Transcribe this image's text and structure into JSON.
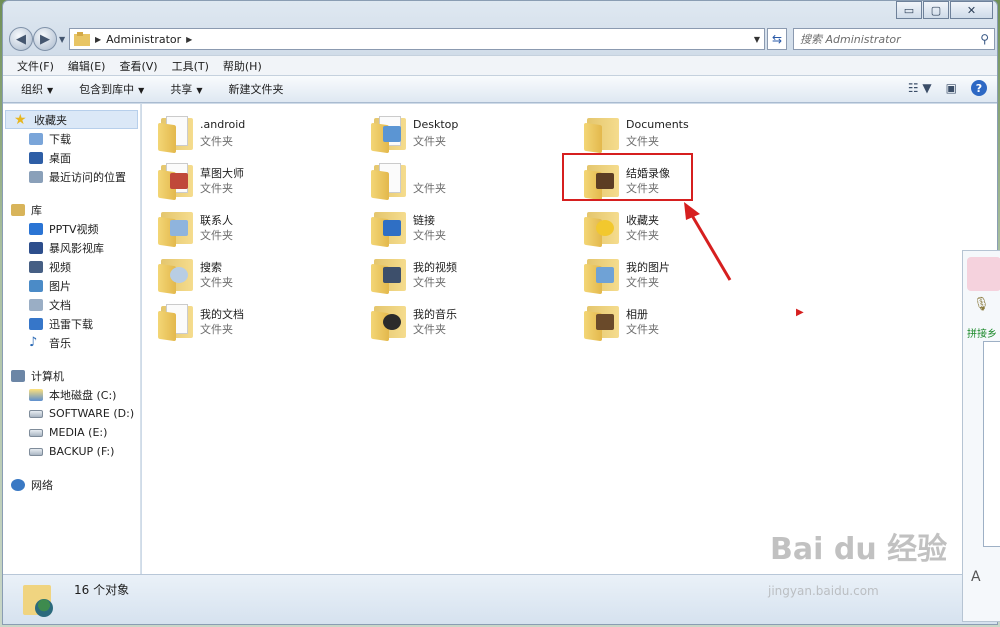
{
  "window": {
    "caption": {
      "min": "▭",
      "max": "▢",
      "close": "✕"
    },
    "address": {
      "path": "Administrator"
    },
    "search": {
      "placeholder": "搜索 Administrator"
    }
  },
  "menubar": [
    "文件(F)",
    "编辑(E)",
    "查看(V)",
    "工具(T)",
    "帮助(H)"
  ],
  "cmdbar": {
    "organize": "组织",
    "include": "包含到库中",
    "share": "共享",
    "new_folder": "新建文件夹"
  },
  "sidebar": {
    "favorites": {
      "label": "收藏夹",
      "items": [
        "下载",
        "桌面",
        "最近访问的位置"
      ]
    },
    "libraries": {
      "label": "库",
      "items": [
        "PPTV视频",
        "暴风影视库",
        "视频",
        "图片",
        "文档",
        "迅雷下载",
        "音乐"
      ]
    },
    "computer": {
      "label": "计算机",
      "items": [
        "本地磁盘 (C:)",
        "SOFTWARE (D:)",
        "MEDIA (E:)",
        "BACKUP (F:)"
      ]
    },
    "network": {
      "label": "网络"
    }
  },
  "files": [
    {
      "name": ".android",
      "type": "文件夹"
    },
    {
      "name": "Desktop",
      "type": "文件夹"
    },
    {
      "name": "Documents",
      "type": "文件夹"
    },
    {
      "name": "草图大师",
      "type": "文件夹"
    },
    {
      "name": "",
      "type": "文件夹"
    },
    {
      "name": "结婚录像",
      "type": "文件夹"
    },
    {
      "name": "联系人",
      "type": "文件夹"
    },
    {
      "name": "链接",
      "type": "文件夹"
    },
    {
      "name": "收藏夹",
      "type": "文件夹"
    },
    {
      "name": "搜索",
      "type": "文件夹"
    },
    {
      "name": "我的视频",
      "type": "文件夹"
    },
    {
      "name": "我的图片",
      "type": "文件夹"
    },
    {
      "name": "我的文档",
      "type": "文件夹"
    },
    {
      "name": "我的音乐",
      "type": "文件夹"
    },
    {
      "name": "相册",
      "type": "文件夹"
    }
  ],
  "status": {
    "count": "16 个对象"
  },
  "side_panel": {
    "label": "拼接乡"
  },
  "watermark": {
    "brand": "Bai du 经验",
    "url": "jingyan.baidu.com"
  },
  "colors": {
    "highlight": "#d61f1f",
    "accent": "#2d68c4"
  }
}
